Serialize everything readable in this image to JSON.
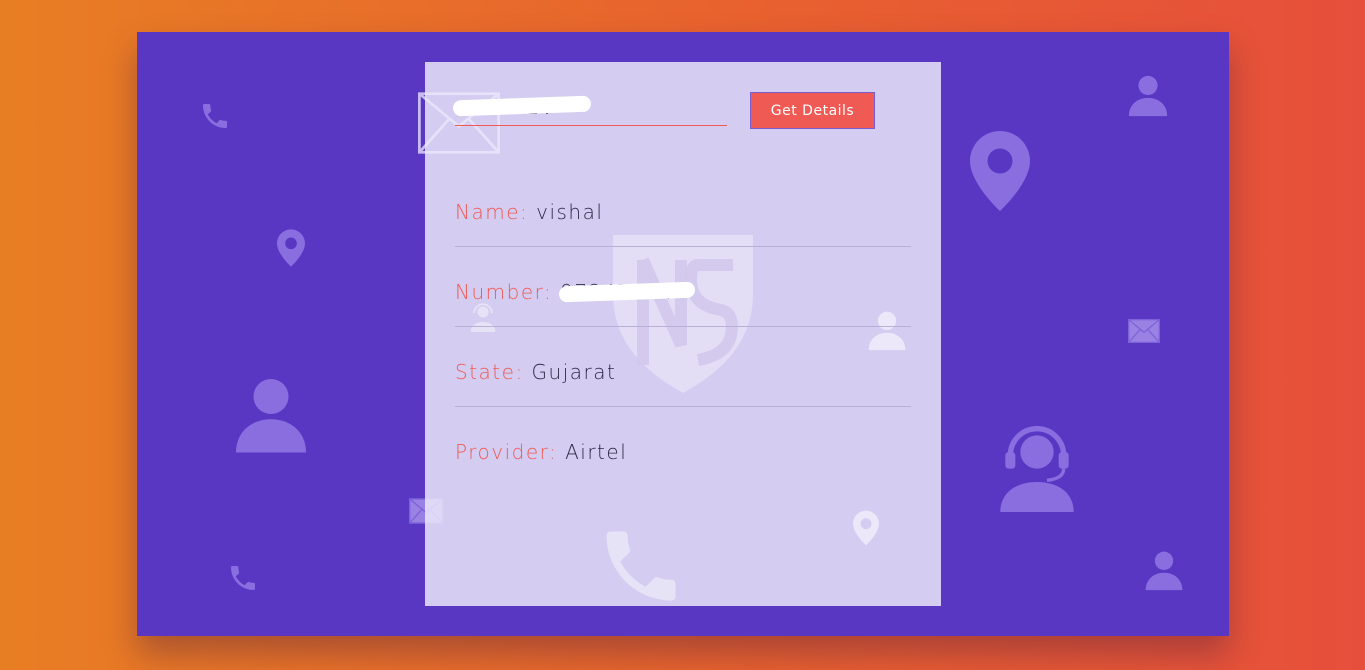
{
  "lookup": {
    "number_value": "97247124",
    "button_label": "Get Details"
  },
  "details": [
    {
      "label": "Name:",
      "value": "vishal"
    },
    {
      "label": "Number:",
      "value": "97247124"
    },
    {
      "label": "State:",
      "value": "Gujarat"
    },
    {
      "label": "Provider:",
      "value": "Airtel"
    }
  ],
  "watermark": {
    "text": "NS"
  },
  "colors": {
    "background_start": "#e87e24",
    "background_end": "#e64f3c",
    "panel": "#5937c3",
    "accent": "#ef5a54",
    "card": "#d2c8ec"
  },
  "icons": [
    "phone-icon",
    "location-pin-icon",
    "user-icon",
    "envelope-icon",
    "headset-support-icon"
  ]
}
